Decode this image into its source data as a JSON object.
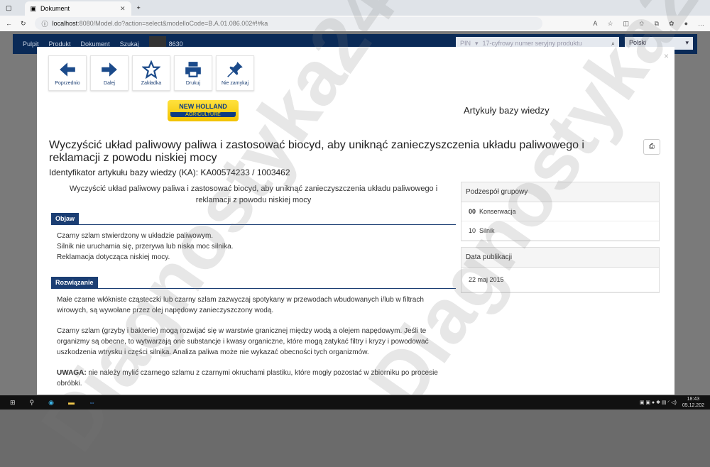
{
  "browser": {
    "tab_title": "Dokument",
    "url_host": "localhost",
    "url_rest": ":8080/Model.do?action=select&modelloCode=B.A.01.086.002#!#ka"
  },
  "nav": {
    "items": [
      "Pulpit",
      "Produkt",
      "Dokument",
      "Szukaj"
    ],
    "model": "8630",
    "pin_label": "PIN",
    "pin_placeholder": "17-cyfrowy numer seryjny produktu",
    "language": "Polski"
  },
  "toolbar": {
    "buttons": [
      {
        "label": "Poprzednio",
        "icon": "arrow-left-icon"
      },
      {
        "label": "Dalej",
        "icon": "arrow-right-icon"
      },
      {
        "label": "Zakładka",
        "icon": "star-icon"
      },
      {
        "label": "Drukuj",
        "icon": "printer-icon"
      },
      {
        "label": "Nie zamykaj",
        "icon": "pin-icon"
      }
    ]
  },
  "logo": {
    "brand": "NEW HOLLAND",
    "sub": "AGRICULTURE"
  },
  "kb_title": "Artykuły bazy wiedzy",
  "article": {
    "title": "Wyczyścić układ paliwowy paliwa i zastosować biocyd, aby uniknąć zanieczyszczenia układu paliwowego i reklamacji z powodu niskiej mocy",
    "identifier": "Identyfikator artykułu bazy wiedzy (KA): KA00574233 / 1003462",
    "subtitle": "Wyczyścić układ paliwowy paliwa i zastosować biocyd, aby uniknąć zanieczyszczenia układu paliwowego i reklamacji z powodu niskiej mocy",
    "symptom_label": "Objaw",
    "symptoms": [
      "Czarny szlam stwierdzony w układzie paliwowym.",
      "Silnik nie uruchamia się, przerywa lub niska moc silnika.",
      "Reklamacja dotycząca niskiej mocy."
    ],
    "solution_label": "Rozwiązanie",
    "solution_p1": "Małe czarne włókniste cząsteczki lub czarny szlam zazwyczaj spotykany w przewodach wbudowanych i/lub w filtrach wirowych, są wywołane przez olej napędowy zanieczyszczony wodą.",
    "solution_p2": "Czarny szlam (grzyby i bakterie) mogą rozwijać się w warstwie granicznej między wodą a olejem napędowym. Jeśli te organizmy są obecne, to wytwarzają one substancje i kwasy organiczne, które mogą zatykać filtry i kryzy i powodować uszkodzenia wtrysku i części silnika. Analiza paliwa może nie wykazać obecności tych organizmów.",
    "warning_label": "UWAGA:",
    "warning_text": " nie należy mylić czarnego szlamu z czarnymi okruchami plastiku, które mogły pozostać w zbiorniku po procesie obróbki."
  },
  "side": {
    "group_title": "Podzespół grupowy",
    "groups": [
      {
        "code": "00",
        "name": "Konserwacja"
      },
      {
        "code": "10",
        "name": "Silnik"
      }
    ],
    "pub_title": "Data publikacji",
    "pub_date": "22 maj 2015"
  },
  "taskbar": {
    "time": "18:43",
    "date": "05.12.202"
  },
  "watermark": "Diagnostyka24"
}
